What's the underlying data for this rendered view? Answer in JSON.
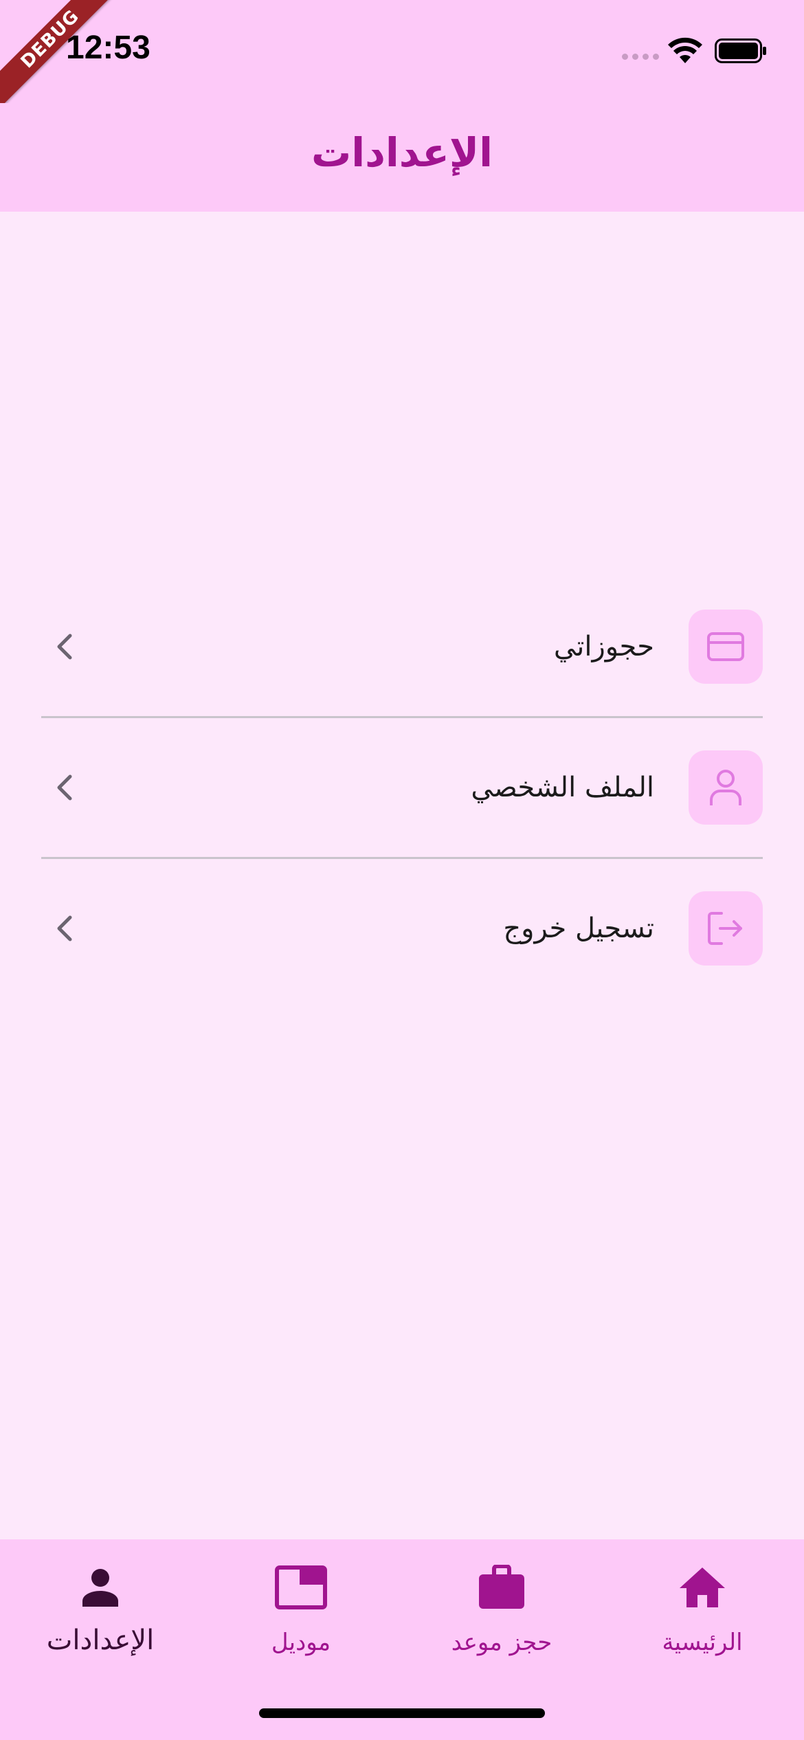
{
  "status_bar": {
    "time": "12:53",
    "debug_label": "DEBUG"
  },
  "app_bar": {
    "title": "الإعدادات"
  },
  "menu": {
    "items": [
      {
        "label": "حجوزاتي",
        "icon": "credit-card-icon"
      },
      {
        "label": "الملف الشخصي",
        "icon": "person-icon"
      },
      {
        "label": "تسجيل خروج",
        "icon": "logout-icon"
      }
    ]
  },
  "bottom_nav": {
    "items": [
      {
        "label": "الإعدادات",
        "icon": "person-filled-icon",
        "active": true
      },
      {
        "label": "موديل",
        "icon": "window-icon",
        "active": false
      },
      {
        "label": "حجز موعد",
        "icon": "briefcase-icon",
        "active": false
      },
      {
        "label": "الرئيسية",
        "icon": "home-icon",
        "active": false
      }
    ]
  },
  "colors": {
    "accent": "#a0148f",
    "bar_background": "#fdc9f8",
    "page_background": "#fde8fb",
    "icon_tint": "#e07ae0",
    "active_nav": "#3a0d36"
  }
}
